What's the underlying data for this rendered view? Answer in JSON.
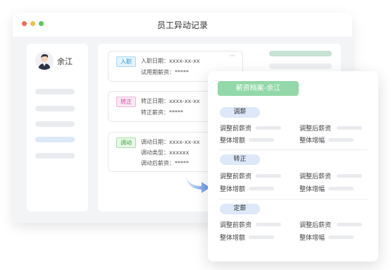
{
  "window": {
    "title": "员工异动记录"
  },
  "sidebar": {
    "user_name": "余江"
  },
  "cards": [
    {
      "tag": "入职",
      "lines": [
        "入职日期：xxxx-xx-xx",
        "试用期薪资：*****"
      ],
      "more": "···"
    },
    {
      "tag": "转正",
      "lines": [
        "转正日期：xxxx-xx-xx",
        "转正薪资：*****"
      ]
    },
    {
      "tag": "调动",
      "lines": [
        "调动日期：xxxx-xx-xx",
        "调动类型：xxxxxx",
        "调动后薪资：*****"
      ]
    }
  ],
  "panel": {
    "title": "薪资档案-余江",
    "sections": [
      {
        "name": "调薪",
        "fields": [
          "调整前薪资",
          "调整后薪资",
          "整体增额",
          "整体增幅"
        ]
      },
      {
        "name": "转正",
        "fields": [
          "调整前薪资",
          "调整后薪资",
          "整体增额",
          "整体增幅"
        ]
      },
      {
        "name": "定薪",
        "fields": [
          "调整前薪资",
          "调整后薪资",
          "整体增额",
          "整体增幅"
        ]
      }
    ]
  },
  "colors": {
    "panel_title_bg": "#92d8a8",
    "section_pill_bg": "#dde8f8",
    "arrow": "#5b8fe0"
  },
  "icons": {
    "avatar": "person-avatar-icon",
    "arrow": "curved-arrow-icon",
    "more": "more-dots-icon"
  }
}
